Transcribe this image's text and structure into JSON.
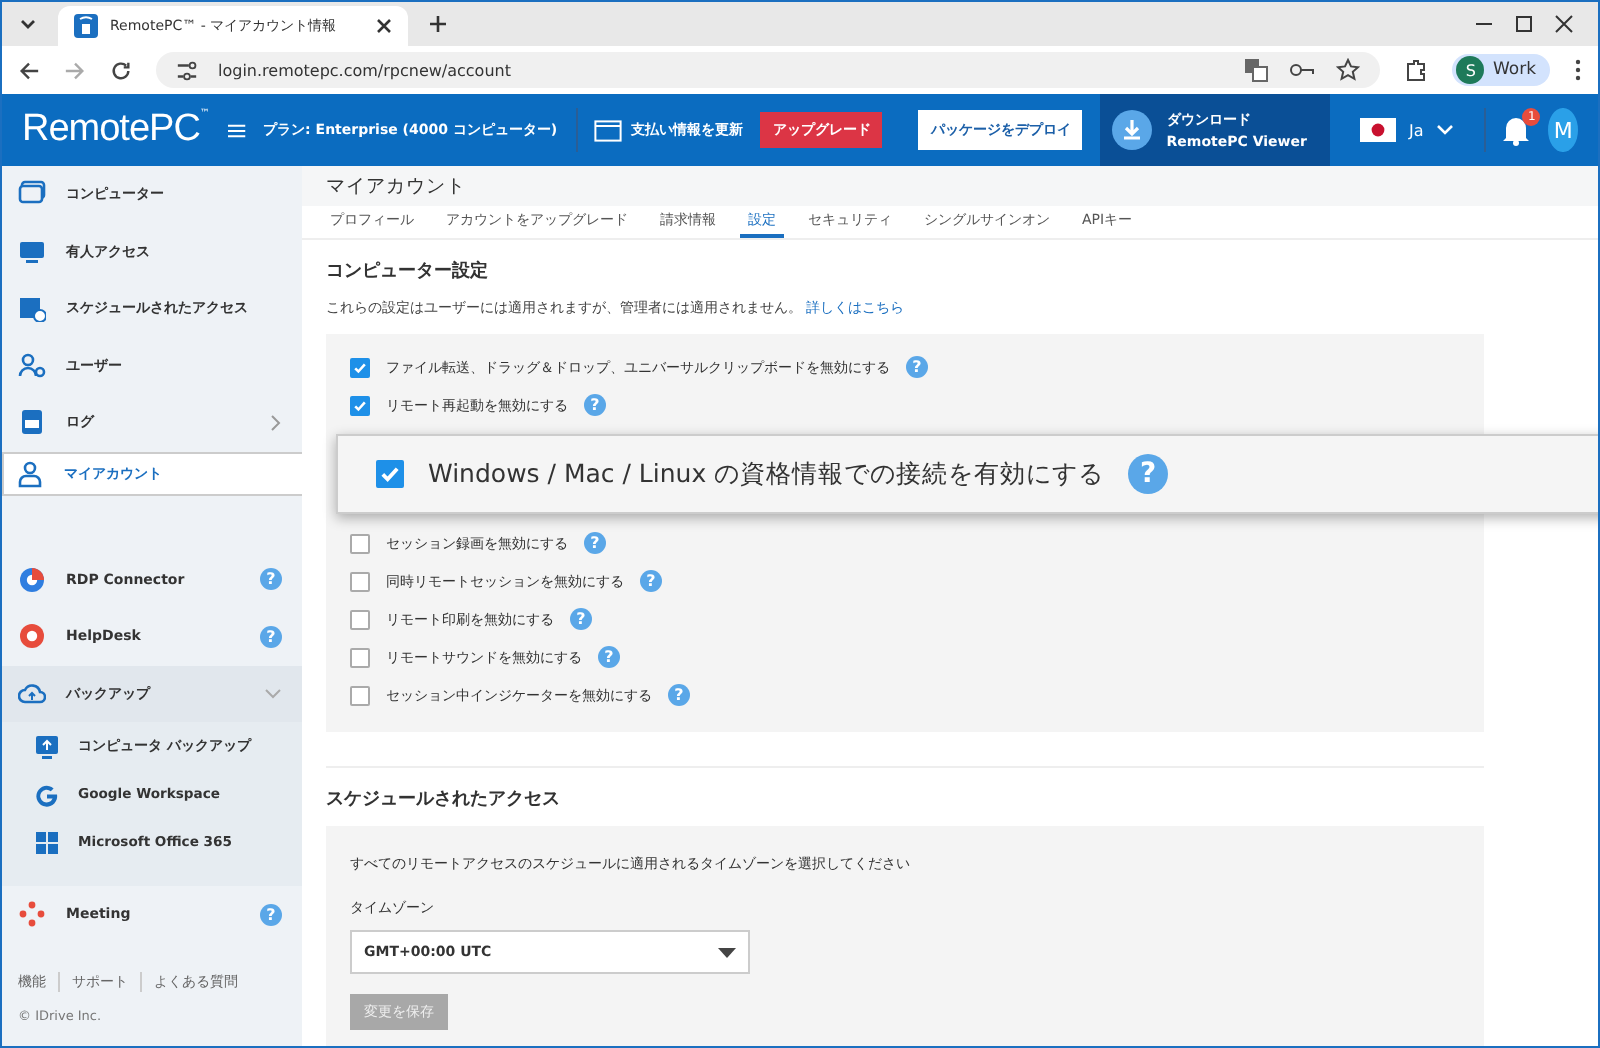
{
  "browser": {
    "tab_title": "RemotePC™ - マイアカウント情報",
    "url": "login.remotepc.com/rpcnew/account",
    "profile_initial": "S",
    "profile": "Work"
  },
  "header": {
    "logo": "RemotePC",
    "logo_mark": "™",
    "plan": "プラン: Enterprise (4000 コンピューター)",
    "billing": "支払い情報を更新",
    "upgrade": "アップグレード",
    "deploy": "パッケージをデプロイ",
    "download_title": "ダウンロード",
    "download_sub": "RemotePC Viewer",
    "language": "Ja",
    "notifications": "1",
    "avatar": "M"
  },
  "sidebar": {
    "items": [
      {
        "label": "コンピューター",
        "selected": false
      },
      {
        "label": "有人アクセス",
        "selected": false
      },
      {
        "label": "スケジュールされたアクセス",
        "selected": false
      },
      {
        "label": "ユーザー",
        "selected": false
      },
      {
        "label": "ログ",
        "selected": false,
        "kind": "submenu"
      },
      {
        "label": "マイアカウント",
        "selected": true
      },
      {
        "label": "RDP Connector",
        "selected": false,
        "kind": "help",
        "gap": true,
        "help": "?"
      },
      {
        "label": "HelpDesk",
        "selected": false,
        "kind": "help",
        "help": "?"
      },
      {
        "label": "バックアップ",
        "selected": false,
        "kind": "group",
        "expanded": true,
        "children": [
          {
            "label": "コンピュータ バックアップ"
          },
          {
            "label": "Google Workspace"
          },
          {
            "label": "Microsoft Office 365"
          }
        ]
      },
      {
        "label": "Meeting",
        "selected": false,
        "kind": "help",
        "help": "?"
      }
    ],
    "footer_links": [
      "機能",
      "サポート",
      "よくある質問"
    ],
    "copyright": "© IDrive Inc."
  },
  "page": {
    "title": "マイアカウント",
    "tabs": [
      {
        "label": "プロフィール",
        "selected": false
      },
      {
        "label": "アカウントをアップグレード",
        "selected": false
      },
      {
        "label": "請求情報",
        "selected": false
      },
      {
        "label": "設定",
        "selected": true
      },
      {
        "label": "セキュリティ",
        "selected": false
      },
      {
        "label": "シングルサインオン",
        "selected": false
      },
      {
        "label": "APIキー",
        "selected": false
      }
    ]
  },
  "computer_settings": {
    "title": "コンピューター設定",
    "description": "これらの設定はユーザーには適用されますが、管理者には適用されません。",
    "link": "詳しくはこちら",
    "options": [
      {
        "label": "ファイル転送、ドラッグ＆ドロップ、ユニバーサルクリップボードを無効にする",
        "checked": true,
        "help": "?"
      },
      {
        "label": "リモート再起動を無効にする",
        "checked": true,
        "help": "?"
      },
      {
        "label": "Windows / Mac / Linux の資格情報での接続を有効にする",
        "checked": true,
        "kind": "callout",
        "help": "?"
      },
      {
        "label": "セッション録画を無効にする",
        "checked": false,
        "help": "?"
      },
      {
        "label": "同時リモートセッションを無効にする",
        "checked": false,
        "help": "?"
      },
      {
        "label": "リモート印刷を無効にする",
        "checked": false,
        "help": "?"
      },
      {
        "label": "リモートサウンドを無効にする",
        "checked": false,
        "help": "?"
      },
      {
        "label": "セッション中インジケーターを無効にする",
        "checked": false,
        "help": "?"
      }
    ]
  },
  "scheduled_access": {
    "title": "スケジュールされたアクセス",
    "description": "すべてのリモートアクセスのスケジュールに適用されるタイムゾーンを選択してください",
    "timezone_label": "タイムゾーン",
    "timezone": "GMT+00:00 UTC",
    "save": "変更を保存",
    "save_disabled": true
  }
}
